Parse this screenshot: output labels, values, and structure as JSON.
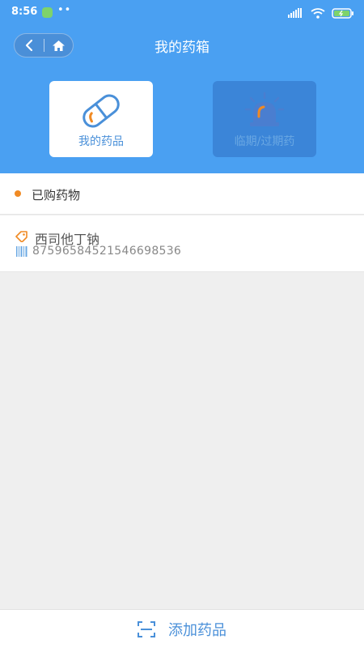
{
  "status_bar": {
    "time": "8:56",
    "dots": "••"
  },
  "header": {
    "title": "我的药箱"
  },
  "tabs": [
    {
      "label": "我的药品",
      "icon": "pill-icon",
      "active": true
    },
    {
      "label": "临期/过期药",
      "icon": "alarm-light-icon",
      "active": false
    }
  ],
  "section": {
    "title": "已购药物"
  },
  "drugs": [
    {
      "name": "西司他丁钠",
      "code": "8759658452154669853​6"
    }
  ],
  "bottom": {
    "add_label": "添加药品"
  },
  "colors": {
    "primary": "#4aa0f2",
    "accent": "#f08a24",
    "text_blue": "#4a90d9"
  }
}
